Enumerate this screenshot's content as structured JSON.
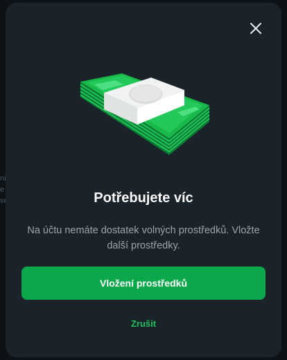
{
  "background": {
    "peek_lines": [
      "ni",
      "e",
      "se"
    ]
  },
  "dialog": {
    "close_icon": "close-icon",
    "illustration_icon": "money-stack-icon",
    "title": "Potřebujete víc",
    "message": "Na účtu nemáte dostatek volných prostředků. Vložte další prostředky.",
    "primary_button_label": "Vložení prostředků",
    "cancel_label": "Zrušit"
  },
  "colors": {
    "overlay": "#0c1216",
    "modal": "#1a2329",
    "accent": "#0aa84a",
    "accent_text": "#21c25e"
  }
}
